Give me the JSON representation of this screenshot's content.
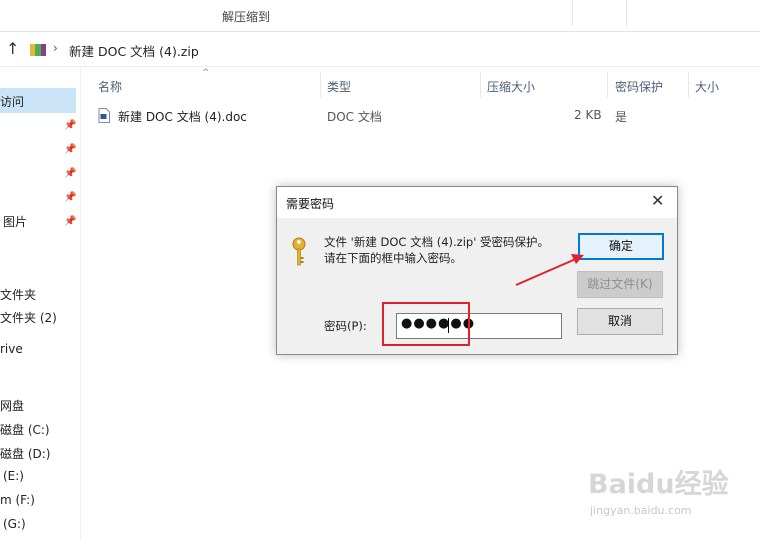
{
  "ribbon": {
    "title": "解压缩到"
  },
  "address": {
    "path": "新建 DOC 文档 (4).zip"
  },
  "nav": {
    "items": [
      "访问",
      "图片",
      "文件夹",
      "文件夹 (2)",
      "rive",
      "",
      "网盘",
      "磁盘 (C:)",
      "磁盘 (D:)",
      "(E:)",
      "m (F:)",
      "(G:)"
    ]
  },
  "columns": {
    "name": "名称",
    "type": "类型",
    "compressed": "压缩大小",
    "protected": "密码保护",
    "size": "大小"
  },
  "files": [
    {
      "name": "新建 DOC 文档 (4).doc",
      "type": "DOC 文档",
      "compressed": "2 KB",
      "protected": "是"
    }
  ],
  "dialog": {
    "title": "需要密码",
    "close": "✕",
    "message_line1": "文件 '新建 DOC 文档 (4).zip' 受密码保护。",
    "message_line2": "请在下面的框中输入密码。",
    "password_label": "密码(P):",
    "password_masked": "●●●●●●",
    "buttons": {
      "ok": "确定",
      "skip": "跳过文件(K)",
      "cancel": "取消"
    }
  },
  "watermark": {
    "text": "Baidu经验",
    "sub": "jingyan.baidu.com"
  },
  "colors": {
    "accent": "#0078d7",
    "highlight": "#e0212c",
    "selection": "#cce4f7"
  }
}
